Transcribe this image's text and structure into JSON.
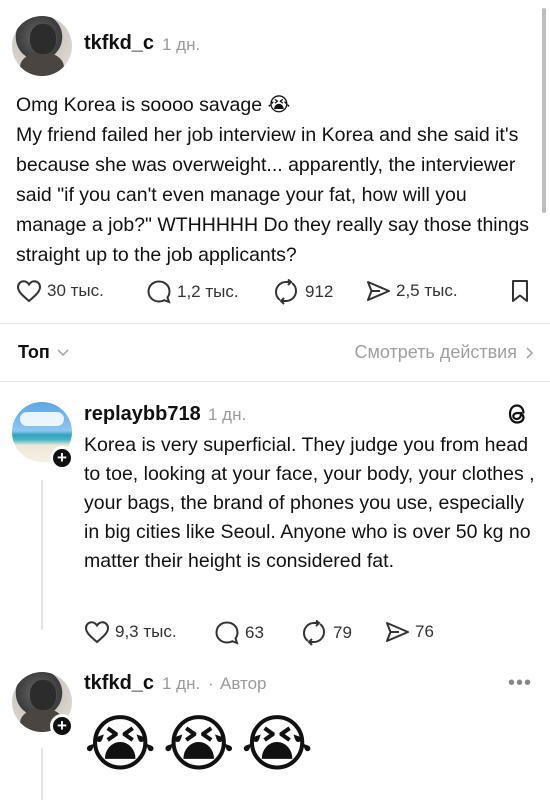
{
  "post": {
    "username": "tkfkd_c",
    "time": "1 дн.",
    "lines": [
      "Omg Korea is soooo savage 😭",
      "My friend failed her job interview in Korea and she said it's because she was overweight... apparently, the interviewer said \"if you can't even manage your fat, how will you manage a job?\" WTHHHHH Do they really say those things straight up to the job applicants?"
    ],
    "metrics": {
      "likes": "30 тыс.",
      "comments": "1,2 тыс.",
      "reposts": "912",
      "shares": "2,5 тыс."
    }
  },
  "sort": {
    "label": "Топ",
    "view_activity": "Смотреть действия"
  },
  "reply": {
    "username": "replaybb718",
    "time": "1 дн.",
    "text": "Korea is very superficial. They judge you from head to toe, looking at your face, your body, your clothes , your bags, the brand of phones you use, especially in big cities like Seoul. Anyone who is over 50 kg no matter their height is considered fat.",
    "metrics": {
      "likes": "9,3 тыс.",
      "comments": "63",
      "reposts": "79",
      "shares": "76"
    }
  },
  "author_reply": {
    "username": "tkfkd_c",
    "time": "1 дн.",
    "author_label": "Автор",
    "more": "•••",
    "emojis": [
      "😭",
      "😭",
      "😭"
    ]
  },
  "icons": {
    "heart": "heart-icon",
    "comment": "comment-icon",
    "repost": "repost-icon",
    "share": "share-icon",
    "bookmark": "bookmark-icon",
    "threads": "threads-logo-icon",
    "plus": "plus-icon"
  },
  "colors": {
    "text": "#111111",
    "muted": "#9a9a9a",
    "divider": "#e6e6e6"
  }
}
